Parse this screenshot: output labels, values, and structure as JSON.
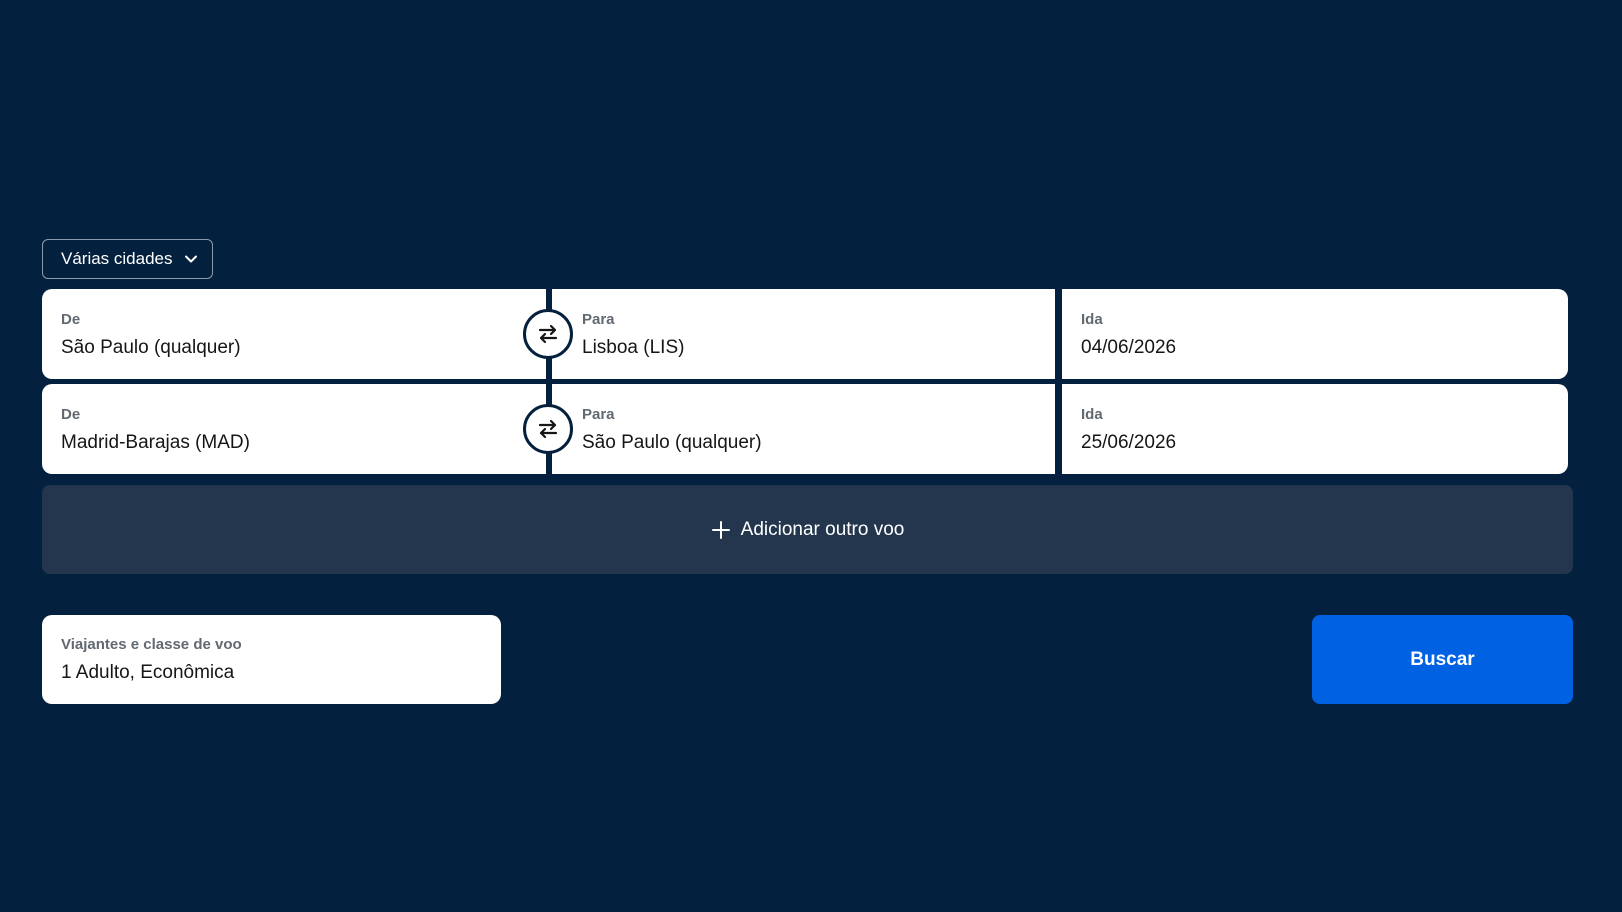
{
  "trip_type": {
    "label": "Várias cidades",
    "icon": "chevron-down-icon"
  },
  "legs": [
    {
      "from_label": "De",
      "from_value": "São Paulo (qualquer)",
      "to_label": "Para",
      "to_value": "Lisboa (LIS)",
      "date_label": "Ida",
      "date_value": "04/06/2026"
    },
    {
      "from_label": "De",
      "from_value": "Madrid-Barajas (MAD)",
      "to_label": "Para",
      "to_value": "São Paulo (qualquer)",
      "date_label": "Ida",
      "date_value": "25/06/2026"
    }
  ],
  "add_flight": {
    "label": "Adicionar outro voo",
    "icon": "plus-icon"
  },
  "travelers": {
    "label": "Viajantes e classe de voo",
    "value": "1 Adulto, Econômica"
  },
  "search": {
    "label": "Buscar"
  },
  "colors": {
    "background": "#03213f",
    "panel": "#24364e",
    "field": "#ffffff",
    "accent": "#0062e3",
    "label_text": "#626971",
    "value_text": "#161616"
  }
}
